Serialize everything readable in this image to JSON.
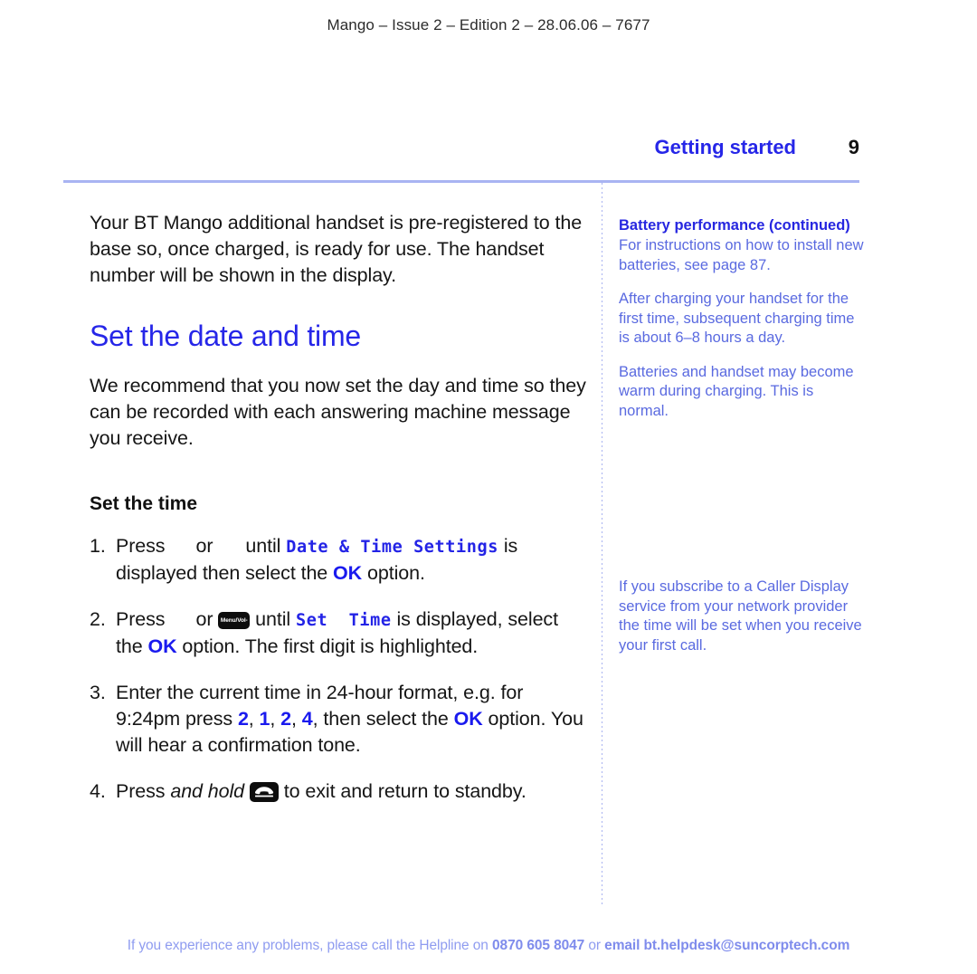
{
  "running_header": "Mango – Issue 2 – Edition 2 – 28.06.06 – 7677",
  "chapter": {
    "title": "Getting started",
    "page_number": "9"
  },
  "main": {
    "intro_paragraph": "Your BT Mango additional handset is pre-registered to the base so, once charged, is ready for use. The handset number will be shown in the display.",
    "section_title": "Set the date and time",
    "section_paragraph": "We recommend that you now set the day and time so they can be recorded with each answering machine message you receive.",
    "subsection_title": "Set the time",
    "steps": [
      {
        "number": "1.",
        "text_1": "Press",
        "text_2": "or",
        "text_3": "until",
        "lcd_text": "Date & Time Settings",
        "text_4": "is displayed then select the",
        "ok_label": "OK",
        "text_5": "option."
      },
      {
        "number": "2.",
        "text_1": "Press",
        "text_2": "or",
        "key_label": "Menu/Vol-",
        "text_3": "until",
        "lcd_text": "Set  Time",
        "text_4": "is displayed, select the",
        "ok_label": "OK",
        "text_5": "option. The first digit is highlighted."
      },
      {
        "number": "3.",
        "text_1": "Enter the current time in 24-hour format, e.g. for 9:24pm press",
        "digits": [
          "2",
          "1",
          "2",
          "4"
        ],
        "text_2": ", then select the",
        "ok_label": "OK",
        "text_3": "option. You will hear a confirmation tone."
      },
      {
        "number": "4.",
        "text_1": "Press",
        "emphasis": "and hold",
        "key_icon_name": "end-call-icon",
        "text_2": "to exit and return to standby."
      }
    ]
  },
  "sidebar": {
    "notes": [
      {
        "heading": "Battery performance (continued)",
        "body": "For instructions on how to install new batteries, see page 87."
      },
      {
        "heading": "",
        "body": "After charging your handset for the first time, subsequent charging time is about 6–8 hours a day."
      },
      {
        "heading": "",
        "body": "Batteries and handset may become warm during charging. This is normal."
      }
    ],
    "late_note": "If you subscribe to a Caller Display service from your network provider the time will be set when you receive your first call."
  },
  "footer": {
    "text_before": "If you experience any problems, please call the Helpline on ",
    "phone": "0870 605 8047",
    "text_middle": " or ",
    "email": "email bt.helpdesk@suncorptech.com"
  },
  "colors": {
    "accent_blue": "#2626e8",
    "lcd_blue": "#2323e6",
    "sidebar_blue": "#5a6ae0",
    "footer_blue": "#8f9cf0",
    "rule": "#a9b4f2"
  }
}
